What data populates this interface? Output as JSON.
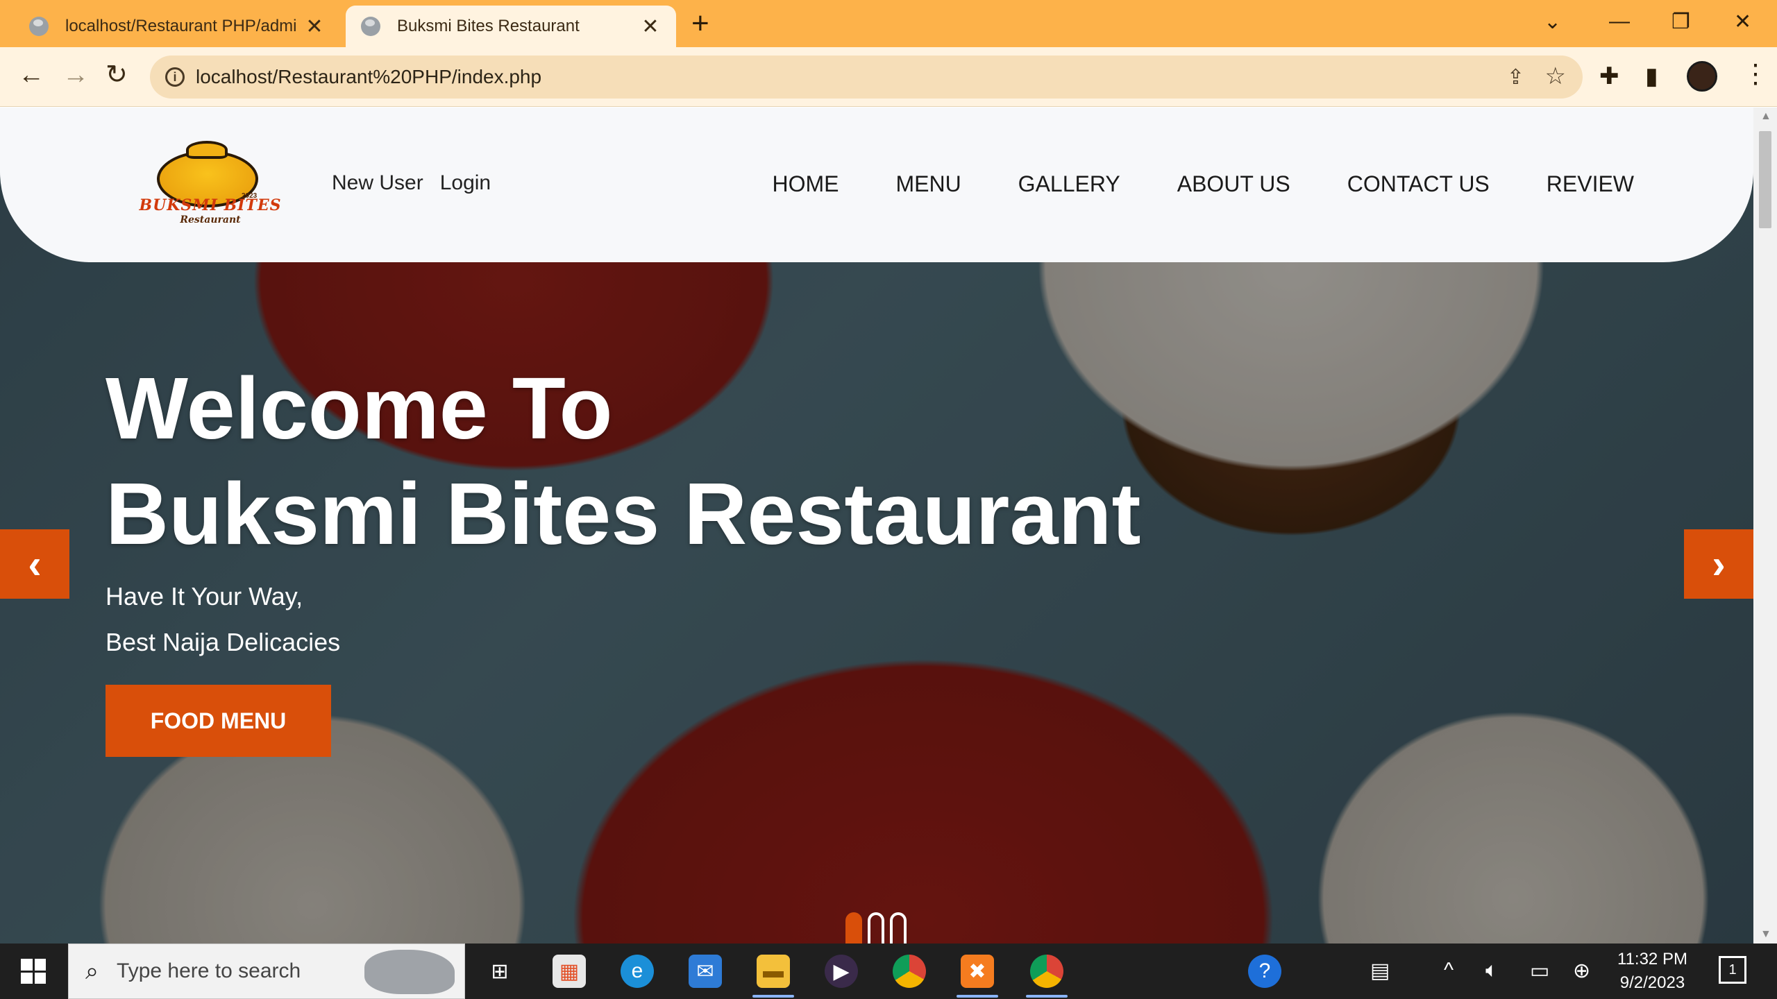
{
  "browser": {
    "tabs": [
      {
        "title": "localhost/Restaurant PHP/admin",
        "active": false
      },
      {
        "title": "Buksmi Bites Restaurant",
        "active": true
      }
    ],
    "new_tab_icon": "plus-icon",
    "url": "localhost/Restaurant%20PHP/index.php"
  },
  "site": {
    "logo": {
      "brand": "BUKSMI BITES",
      "sub": "Restaurant",
      "year": "2023"
    },
    "user_links": [
      "New User",
      "Login"
    ],
    "nav": [
      "HOME",
      "MENU",
      "GALLERY",
      "ABOUT US",
      "CONTACT US",
      "REVIEW"
    ],
    "hero": {
      "line1": "Welcome To",
      "line2": "Buksmi Bites Restaurant",
      "sub1": "Have It Your Way,",
      "sub2": "Best Naija Delicacies",
      "cta": "FOOD MENU"
    },
    "carousel": {
      "slides": 3,
      "active_index": 0
    },
    "accent_color": "#d94f0a"
  },
  "taskbar": {
    "search_placeholder": "Type here to search",
    "time": "11:32 PM",
    "date": "9/2/2023",
    "notification_count": "1"
  }
}
